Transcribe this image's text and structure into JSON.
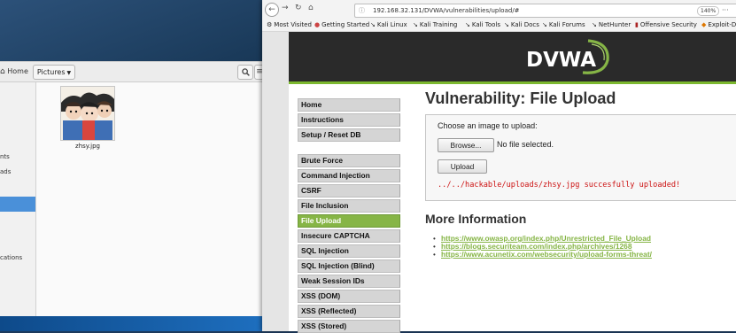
{
  "file_manager": {
    "home_label": "Home",
    "path_button": "Pictures",
    "sidebar_items": [
      "nts",
      "ads",
      "cations"
    ],
    "file_name": "zhsy.jpg"
  },
  "browser": {
    "url": "192.168.32.131/DVWA/vulnerabilities/upload/#",
    "zoom": "140%",
    "bookmarks": [
      "Most Visited",
      "Getting Started",
      "Kali Linux",
      "Kali Training",
      "Kali Tools",
      "Kali Docs",
      "Kali Forums",
      "NetHunter",
      "Offensive Security",
      "Exploit-DB"
    ]
  },
  "dvwa": {
    "logo_text": "DVWA",
    "menu": [
      "Home",
      "Instructions",
      "Setup / Reset DB",
      "Brute Force",
      "Command Injection",
      "CSRF",
      "File Inclusion",
      "File Upload",
      "Insecure CAPTCHA",
      "SQL Injection",
      "SQL Injection (Blind)",
      "Weak Session IDs",
      "XSS (DOM)",
      "XSS (Reflected)",
      "XSS (Stored)"
    ],
    "active_menu": "File Upload",
    "page_title": "Vulnerability: File Upload",
    "upload_prompt": "Choose an image to upload:",
    "browse_label": "Browse...",
    "no_file_text": "No file selected.",
    "upload_label": "Upload",
    "upload_result": "../../hackable/uploads/zhsy.jpg succesfully uploaded!",
    "more_info_title": "More Information",
    "links": [
      "https://www.owasp.org/index.php/Unrestricted_File_Upload",
      "https://blogs.securiteam.com/index.php/archives/1268",
      "https://www.acunetix.com/websecurity/upload-forms-threat/"
    ]
  },
  "colors": {
    "accent_green": "#86b546",
    "error_red": "#cc1111",
    "header_dark": "#2a2a2a",
    "selection_blue": "#4a90d9"
  }
}
